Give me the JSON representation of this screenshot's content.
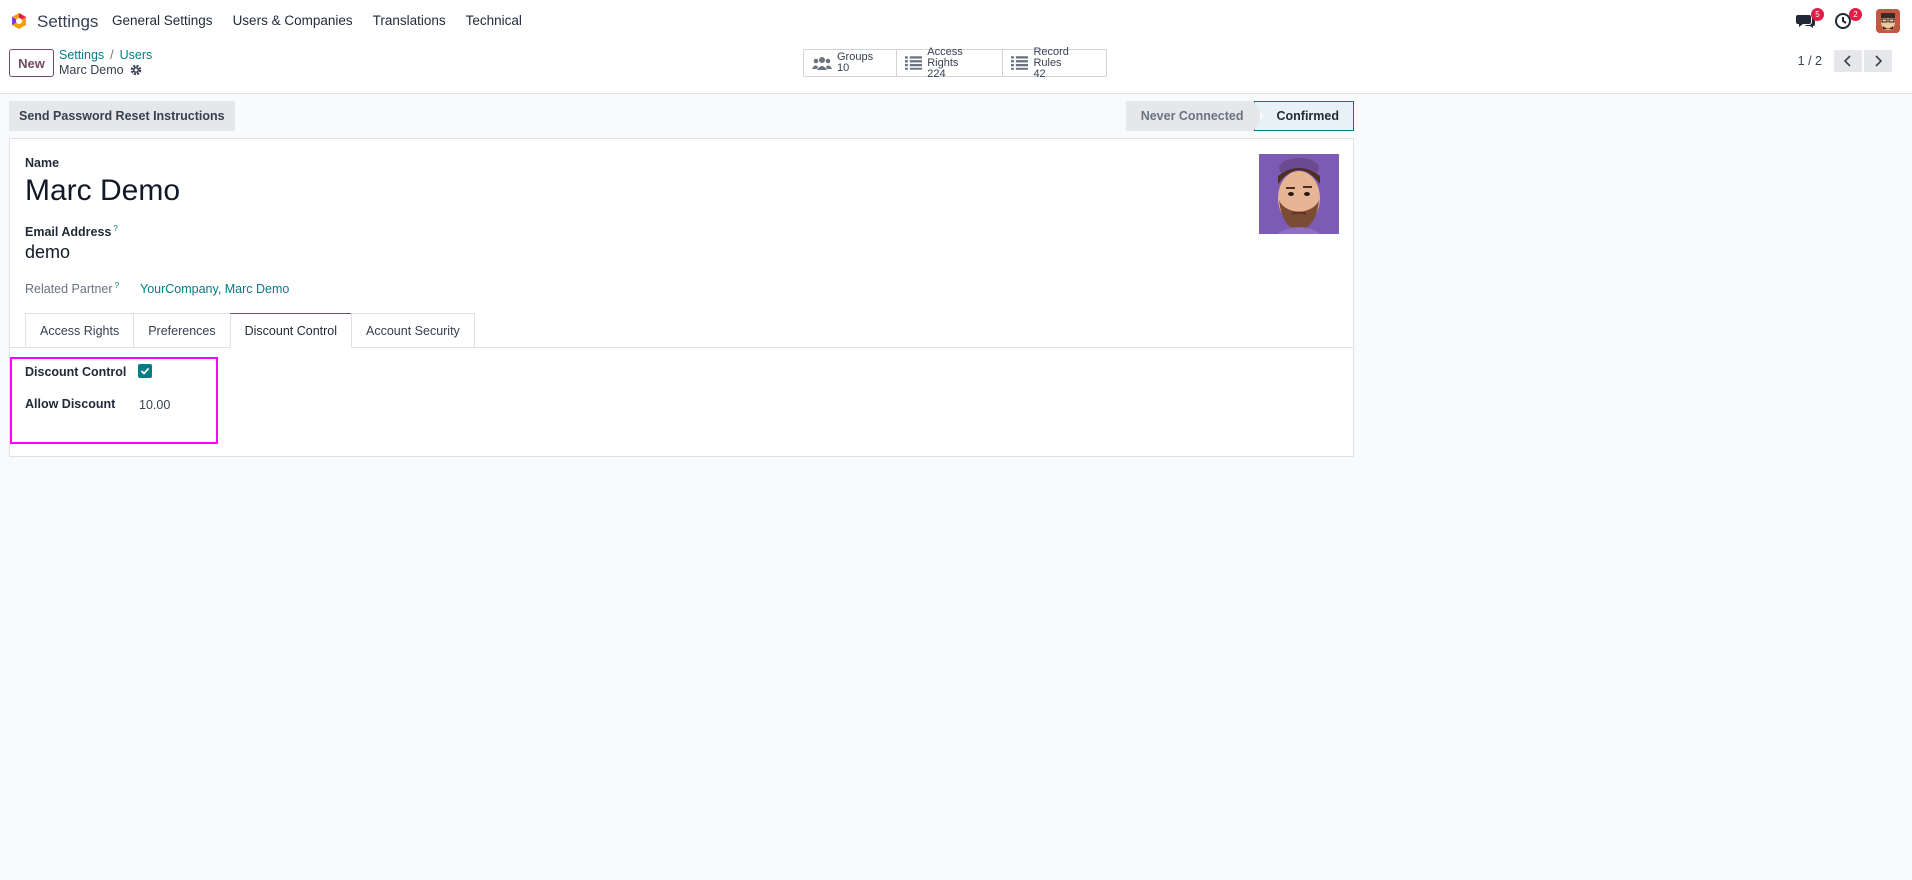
{
  "navbar": {
    "app_name": "Settings",
    "menu": [
      "General Settings",
      "Users & Companies",
      "Translations",
      "Technical"
    ],
    "messages_badge": "5",
    "activities_badge": "2"
  },
  "control_panel": {
    "new_label": "New",
    "breadcrumb": [
      "Settings",
      "Users"
    ],
    "breadcrumb_sep": "/",
    "record_name": "Marc Demo",
    "smart_buttons": [
      {
        "label": "Groups",
        "value": "10",
        "icon": "users-icon"
      },
      {
        "label": "Access Rights",
        "value": "224",
        "icon": "list-icon"
      },
      {
        "label": "Record Rules",
        "value": "42",
        "icon": "list-icon"
      }
    ],
    "pager": "1 / 2"
  },
  "status": {
    "reset_button": "Send Password Reset Instructions",
    "stages": [
      "Never Connected",
      "Confirmed"
    ],
    "active_stage": "Confirmed"
  },
  "form": {
    "name_label": "Name",
    "name_value": "Marc Demo",
    "email_label": "Email Address",
    "email_help": "?",
    "email_value": "demo",
    "partner_label": "Related Partner",
    "partner_help": "?",
    "partner_value": "YourCompany, Marc Demo",
    "tabs": [
      "Access Rights",
      "Preferences",
      "Discount Control",
      "Account Security"
    ],
    "active_tab": "Discount Control",
    "discount_control_label": "Discount Control",
    "discount_control_checked": true,
    "allow_discount_label": "Allow Discount",
    "allow_discount_value": "10.00"
  },
  "colors": {
    "brand": "#714b67",
    "accent": "#017e84",
    "highlight": "#ff00ff",
    "badge": "#e11d48"
  }
}
